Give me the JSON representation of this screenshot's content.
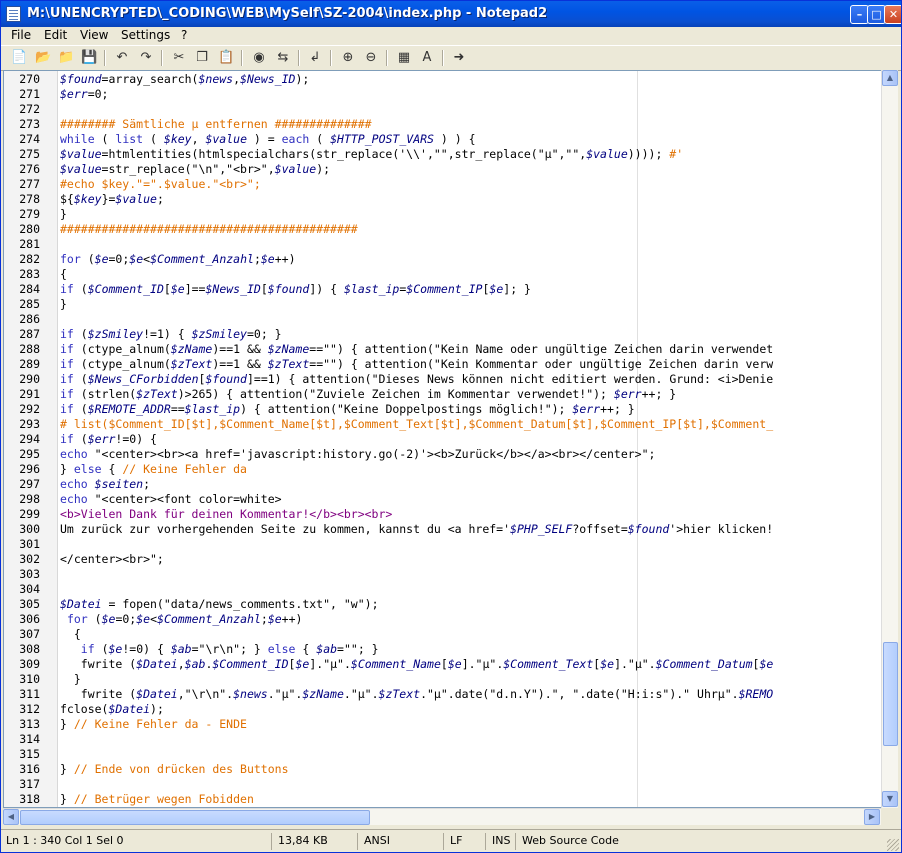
{
  "window": {
    "title": "M:\\UNENCRYPTED\\_CODING\\WEB\\MySelf\\SZ-2004\\index.php - Notepad2"
  },
  "menu": [
    "File",
    "Edit",
    "View",
    "Settings",
    "?"
  ],
  "toolbar": [
    "new-icon",
    "open-icon",
    "browse-icon",
    "save-icon",
    "undo-icon",
    "redo-icon",
    "cut-icon",
    "copy-icon",
    "paste-icon",
    "find-icon",
    "replace-icon",
    "wordwrap-icon",
    "zoom-in-icon",
    "zoom-out-icon",
    "scheme-icon",
    "font-icon",
    "exit-icon"
  ],
  "colors": {
    "keyword": "#3030c0",
    "variable": "#000080",
    "string": "#000000",
    "comment": "#e07000",
    "html": "#800080",
    "plain": "#000000"
  },
  "lines": [
    {
      "n": "270",
      "t": [
        [
          "$found",
          "v"
        ],
        [
          "=array_search(",
          ""
        ],
        [
          "$news",
          "v"
        ],
        [
          ",",
          ""
        ],
        [
          "$News_ID",
          "v"
        ],
        [
          ");",
          ""
        ]
      ]
    },
    {
      "n": "271",
      "t": [
        [
          "$err",
          "v"
        ],
        [
          "=0;",
          ""
        ]
      ]
    },
    {
      "n": "272",
      "t": []
    },
    {
      "n": "273",
      "t": [
        [
          "######## Sämtliche µ entfernen ##############",
          "c"
        ]
      ]
    },
    {
      "n": "274",
      "t": [
        [
          "while",
          "k"
        ],
        [
          " ( ",
          ""
        ],
        [
          "list",
          "k"
        ],
        [
          " ( ",
          ""
        ],
        [
          "$key",
          "v"
        ],
        [
          ", ",
          ""
        ],
        [
          "$value",
          "v"
        ],
        [
          " ) = ",
          ""
        ],
        [
          "each",
          "k"
        ],
        [
          " ( ",
          ""
        ],
        [
          "$HTTP_POST_VARS",
          "v"
        ],
        [
          " ) ) {",
          ""
        ]
      ]
    },
    {
      "n": "275",
      "t": [
        [
          "$value",
          "v"
        ],
        [
          "=htmlentities(htmlspecialchars(str_replace('\\\\',\"\",str_replace(\"µ\",\"\",",
          ""
        ],
        [
          "$value",
          "v"
        ],
        [
          ")))); ",
          ""
        ],
        [
          "#'",
          "c"
        ]
      ]
    },
    {
      "n": "276",
      "t": [
        [
          "$value",
          "v"
        ],
        [
          "=str_replace(\"\\n\",\"<br>\",",
          ""
        ],
        [
          "$value",
          "v"
        ],
        [
          ");",
          ""
        ]
      ]
    },
    {
      "n": "277",
      "t": [
        [
          "#echo $key.\"=\".$value.\"<br>\";",
          "c"
        ]
      ]
    },
    {
      "n": "278",
      "t": [
        [
          "${",
          ""
        ],
        [
          "$key",
          "v"
        ],
        [
          "}=",
          ""
        ],
        [
          "$value",
          "v"
        ],
        [
          ";",
          ""
        ]
      ]
    },
    {
      "n": "279",
      "t": [
        [
          "}",
          ""
        ]
      ]
    },
    {
      "n": "280",
      "t": [
        [
          "###########################################",
          "c"
        ]
      ]
    },
    {
      "n": "281",
      "t": []
    },
    {
      "n": "282",
      "t": [
        [
          "for",
          "k"
        ],
        [
          " (",
          ""
        ],
        [
          "$e",
          "v"
        ],
        [
          "=0;",
          ""
        ],
        [
          "$e",
          "v"
        ],
        [
          "<",
          ""
        ],
        [
          "$Comment_Anzahl",
          "v"
        ],
        [
          ";",
          ""
        ],
        [
          "$e",
          "v"
        ],
        [
          "++)",
          ""
        ]
      ]
    },
    {
      "n": "283",
      "t": [
        [
          "{",
          ""
        ]
      ]
    },
    {
      "n": "284",
      "t": [
        [
          "if",
          "k"
        ],
        [
          " (",
          ""
        ],
        [
          "$Comment_ID",
          "v"
        ],
        [
          "[",
          ""
        ],
        [
          "$e",
          "v"
        ],
        [
          "]==",
          ""
        ],
        [
          "$News_ID",
          "v"
        ],
        [
          "[",
          ""
        ],
        [
          "$found",
          "v"
        ],
        [
          "]) { ",
          ""
        ],
        [
          "$last_ip",
          "v"
        ],
        [
          "=",
          ""
        ],
        [
          "$Comment_IP",
          "v"
        ],
        [
          "[",
          ""
        ],
        [
          "$e",
          "v"
        ],
        [
          "]; }",
          ""
        ]
      ]
    },
    {
      "n": "285",
      "t": [
        [
          "}",
          ""
        ]
      ]
    },
    {
      "n": "286",
      "t": []
    },
    {
      "n": "287",
      "t": [
        [
          "if",
          "k"
        ],
        [
          " (",
          ""
        ],
        [
          "$zSmiley",
          "v"
        ],
        [
          "!=1) { ",
          ""
        ],
        [
          "$zSmiley",
          "v"
        ],
        [
          "=0; }",
          ""
        ]
      ]
    },
    {
      "n": "288",
      "t": [
        [
          "if",
          "k"
        ],
        [
          " (ctype_alnum(",
          ""
        ],
        [
          "$zName",
          "v"
        ],
        [
          ")==1 && ",
          ""
        ],
        [
          "$zName",
          "v"
        ],
        [
          "==\"\") { attention(\"Kein Name oder ungültige Zeichen darin verwendet",
          ""
        ]
      ]
    },
    {
      "n": "289",
      "t": [
        [
          "if",
          "k"
        ],
        [
          " (ctype_alnum(",
          ""
        ],
        [
          "$zText",
          "v"
        ],
        [
          ")==1 && ",
          ""
        ],
        [
          "$zText",
          "v"
        ],
        [
          "==\"\") { attention(\"Kein Kommentar oder ungültige Zeichen darin verw",
          ""
        ]
      ]
    },
    {
      "n": "290",
      "t": [
        [
          "if",
          "k"
        ],
        [
          " (",
          ""
        ],
        [
          "$News_CForbidden",
          "v"
        ],
        [
          "[",
          ""
        ],
        [
          "$found",
          "v"
        ],
        [
          "]==1) { attention(\"Dieses News können nicht editiert werden. Grund: <i>Denie",
          ""
        ]
      ]
    },
    {
      "n": "291",
      "t": [
        [
          "if",
          "k"
        ],
        [
          " (strlen(",
          ""
        ],
        [
          "$zText",
          "v"
        ],
        [
          ")>265) { attention(\"Zuviele Zeichen im Kommentar verwendet!\"); ",
          ""
        ],
        [
          "$err",
          "v"
        ],
        [
          "++; }",
          ""
        ]
      ]
    },
    {
      "n": "292",
      "t": [
        [
          "if",
          "k"
        ],
        [
          " (",
          ""
        ],
        [
          "$REMOTE_ADDR",
          "v"
        ],
        [
          "==",
          ""
        ],
        [
          "$last_ip",
          "v"
        ],
        [
          ") { attention(\"Keine Doppelpostings möglich!\"); ",
          ""
        ],
        [
          "$err",
          "v"
        ],
        [
          "++; }",
          ""
        ]
      ]
    },
    {
      "n": "293",
      "t": [
        [
          "# list($Comment_ID[$t],$Comment_Name[$t],$Comment_Text[$t],$Comment_Datum[$t],$Comment_IP[$t],$Comment_",
          "c"
        ]
      ]
    },
    {
      "n": "294",
      "t": [
        [
          "if",
          "k"
        ],
        [
          " (",
          ""
        ],
        [
          "$err",
          "v"
        ],
        [
          "!=0) {",
          ""
        ]
      ]
    },
    {
      "n": "295",
      "t": [
        [
          "echo",
          "k"
        ],
        [
          " \"<center><br><a href='javascript:history.go(-2)'><b>Zurück</b></a><br></center>\";",
          ""
        ]
      ]
    },
    {
      "n": "296",
      "t": [
        [
          "} ",
          ""
        ],
        [
          "else",
          "k"
        ],
        [
          " { ",
          ""
        ],
        [
          "// Keine Fehler da",
          "c"
        ]
      ]
    },
    {
      "n": "297",
      "t": [
        [
          "echo",
          "k"
        ],
        [
          " ",
          ""
        ],
        [
          "$seiten",
          "v"
        ],
        [
          ";",
          ""
        ]
      ]
    },
    {
      "n": "298",
      "t": [
        [
          "echo",
          "k"
        ],
        [
          " \"<center><font color=white>",
          ""
        ]
      ]
    },
    {
      "n": "299",
      "t": [
        [
          "<b>Vielen Dank für deinen Kommentar!</b><br><br>",
          "h"
        ]
      ]
    },
    {
      "n": "300",
      "t": [
        [
          "Um zurück zur vorhergehenden Seite zu kommen, kannst du <a href='",
          ""
        ],
        [
          "$PHP_SELF",
          "v"
        ],
        [
          "?offset=",
          ""
        ],
        [
          "$found",
          "v"
        ],
        [
          "'>hier klicken!",
          ""
        ]
      ]
    },
    {
      "n": "301",
      "t": []
    },
    {
      "n": "302",
      "t": [
        [
          "</center><br>\";",
          ""
        ]
      ]
    },
    {
      "n": "303",
      "t": []
    },
    {
      "n": "304",
      "t": []
    },
    {
      "n": "305",
      "t": [
        [
          "$Datei",
          "v"
        ],
        [
          " = fopen(\"data/news_comments.txt\", \"w\");",
          ""
        ]
      ]
    },
    {
      "n": "306",
      "t": [
        [
          " ",
          ""
        ],
        [
          "for",
          "k"
        ],
        [
          " (",
          ""
        ],
        [
          "$e",
          "v"
        ],
        [
          "=0;",
          ""
        ],
        [
          "$e",
          "v"
        ],
        [
          "<",
          ""
        ],
        [
          "$Comment_Anzahl",
          "v"
        ],
        [
          ";",
          ""
        ],
        [
          "$e",
          "v"
        ],
        [
          "++)",
          ""
        ]
      ]
    },
    {
      "n": "307",
      "t": [
        [
          "  {",
          ""
        ]
      ]
    },
    {
      "n": "308",
      "t": [
        [
          "   ",
          ""
        ],
        [
          "if",
          "k"
        ],
        [
          " (",
          ""
        ],
        [
          "$e",
          "v"
        ],
        [
          "!=0) { ",
          ""
        ],
        [
          "$ab",
          "v"
        ],
        [
          "=\"\\r\\n\"; } ",
          ""
        ],
        [
          "else",
          "k"
        ],
        [
          " { ",
          ""
        ],
        [
          "$ab",
          "v"
        ],
        [
          "=\"\"; }",
          ""
        ]
      ]
    },
    {
      "n": "309",
      "t": [
        [
          "   fwrite (",
          ""
        ],
        [
          "$Datei",
          "v"
        ],
        [
          ",",
          ""
        ],
        [
          "$ab",
          "v"
        ],
        [
          ".",
          ""
        ],
        [
          "$Comment_ID",
          "v"
        ],
        [
          "[",
          ""
        ],
        [
          "$e",
          "v"
        ],
        [
          "].\"µ\".",
          ""
        ],
        [
          "$Comment_Name",
          "v"
        ],
        [
          "[",
          ""
        ],
        [
          "$e",
          "v"
        ],
        [
          "].\"µ\".",
          ""
        ],
        [
          "$Comment_Text",
          "v"
        ],
        [
          "[",
          ""
        ],
        [
          "$e",
          "v"
        ],
        [
          "].\"µ\".",
          ""
        ],
        [
          "$Comment_Datum",
          "v"
        ],
        [
          "[",
          ""
        ],
        [
          "$e",
          "v"
        ]
      ]
    },
    {
      "n": "310",
      "t": [
        [
          "  }",
          ""
        ]
      ]
    },
    {
      "n": "311",
      "t": [
        [
          "   fwrite (",
          ""
        ],
        [
          "$Datei",
          "v"
        ],
        [
          ",\"\\r\\n\".",
          ""
        ],
        [
          "$news",
          "v"
        ],
        [
          ".\"µ\".",
          ""
        ],
        [
          "$zName",
          "v"
        ],
        [
          ".\"µ\".",
          ""
        ],
        [
          "$zText",
          "v"
        ],
        [
          ".\"µ\".date(\"d.n.Y\").\", \".date(\"H:i:s\").\" Uhrµ\".",
          ""
        ],
        [
          "$REMO",
          "v"
        ]
      ]
    },
    {
      "n": "312",
      "t": [
        [
          "fclose(",
          ""
        ],
        [
          "$Datei",
          "v"
        ],
        [
          ");",
          ""
        ]
      ]
    },
    {
      "n": "313",
      "t": [
        [
          "} ",
          ""
        ],
        [
          "// Keine Fehler da - ENDE",
          "c"
        ]
      ]
    },
    {
      "n": "314",
      "t": []
    },
    {
      "n": "315",
      "t": []
    },
    {
      "n": "316",
      "t": [
        [
          "} ",
          ""
        ],
        [
          "// Ende von drücken des Buttons",
          "c"
        ]
      ]
    },
    {
      "n": "317",
      "t": []
    },
    {
      "n": "318",
      "t": [
        [
          "} ",
          ""
        ],
        [
          "// Betrüger wegen Fobidden",
          "c"
        ]
      ]
    }
  ],
  "status": {
    "position": "Ln 1 : 340   Col 1   Sel 0",
    "size": "13,84 KB",
    "encoding": "ANSI",
    "eol": "LF",
    "mode": "INS",
    "scheme": "Web Source Code"
  }
}
